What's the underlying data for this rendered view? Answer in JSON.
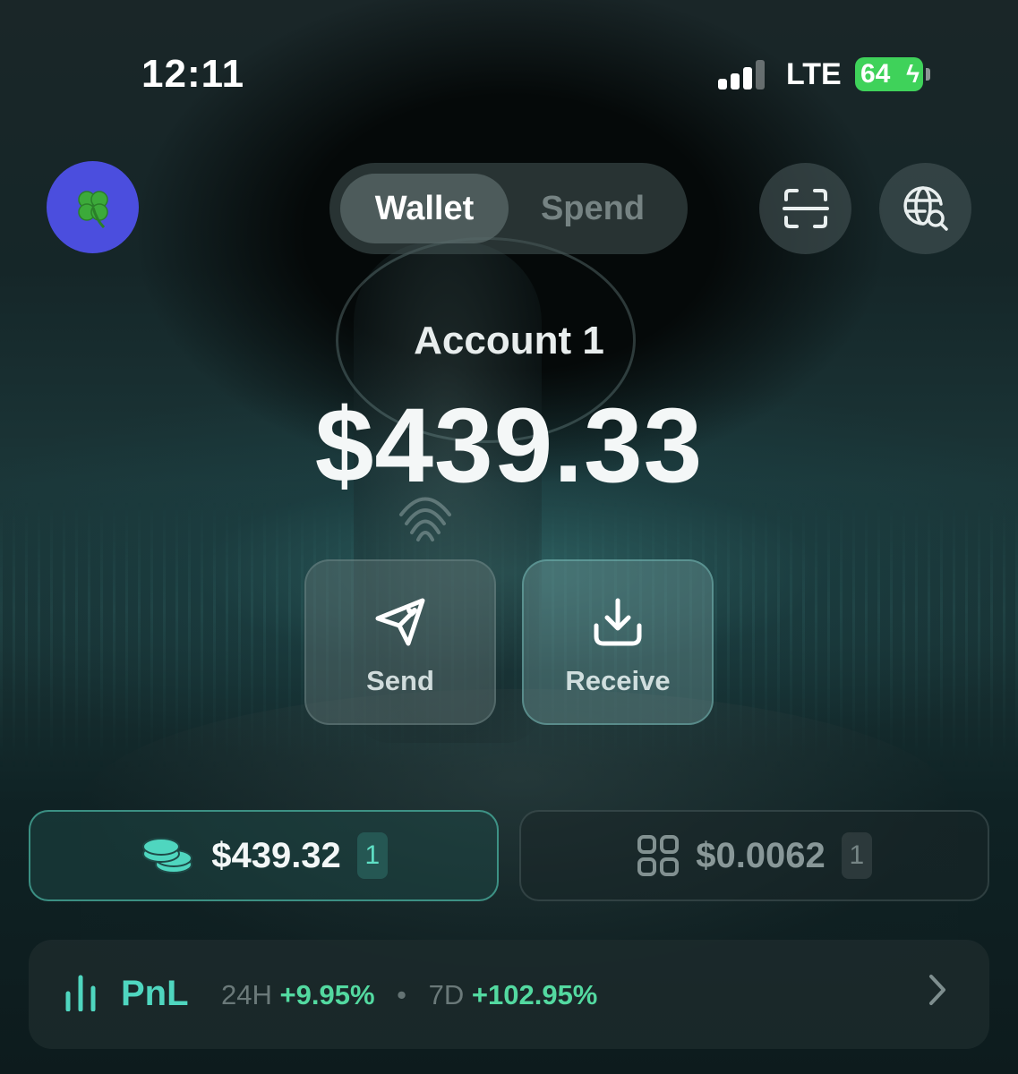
{
  "status_bar": {
    "time": "12:11",
    "network": "LTE",
    "battery": "64",
    "battery_color": "#3fd25a"
  },
  "header": {
    "avatar_emoji": "🍀",
    "tabs": [
      {
        "label": "Wallet",
        "active": true
      },
      {
        "label": "Spend",
        "active": false
      }
    ],
    "icons": [
      "scan-icon",
      "globe-search-icon"
    ]
  },
  "account": {
    "name": "Account 1",
    "balance": "$439.33"
  },
  "actions": {
    "send_label": "Send",
    "receive_label": "Receive"
  },
  "assets": {
    "tokens": {
      "value": "$439.32",
      "count": "1",
      "icon": "coins-icon"
    },
    "nfts": {
      "value": "$0.0062",
      "count": "1",
      "icon": "grid-icon"
    }
  },
  "pnl": {
    "title": "PnL",
    "period_1_label": "24H",
    "period_1_value": "+9.95%",
    "period_2_label": "7D",
    "period_2_value": "+102.95%"
  },
  "colors": {
    "accent": "#4fd6bf",
    "positive": "#53d9a0",
    "avatar_bg": "#4b4ede"
  }
}
